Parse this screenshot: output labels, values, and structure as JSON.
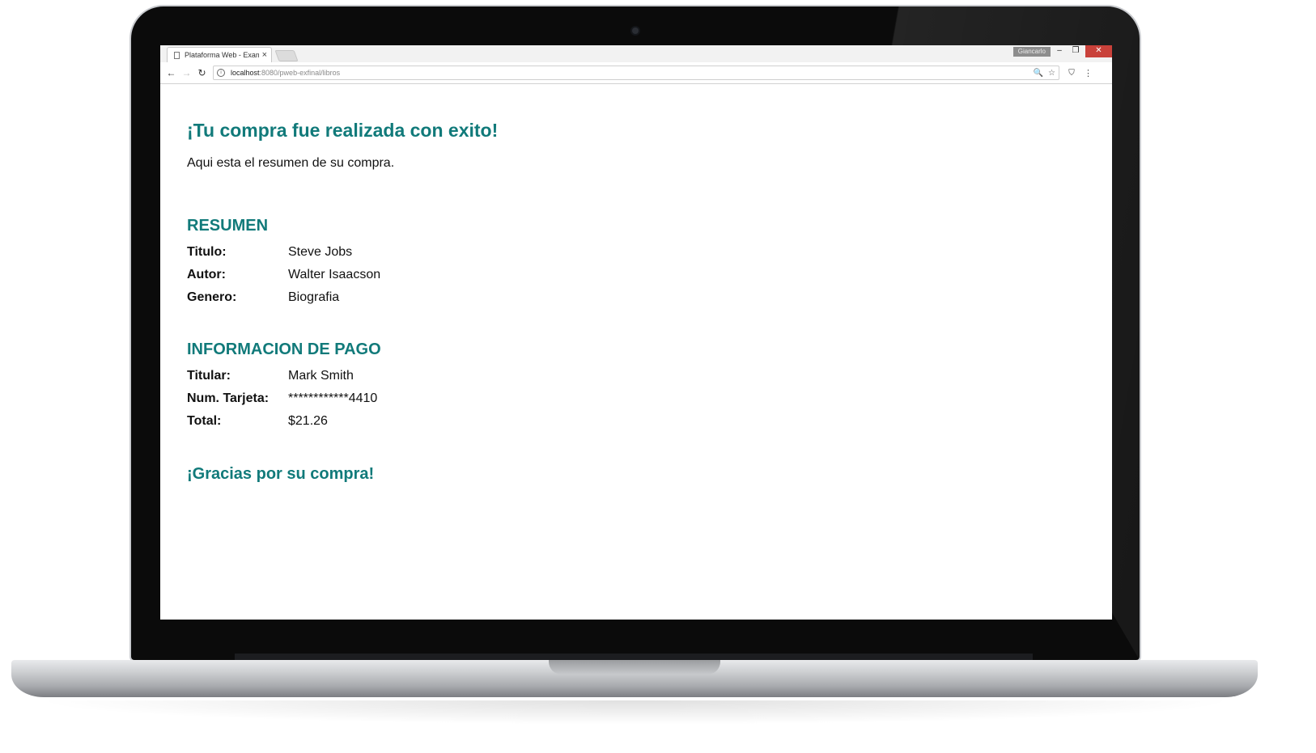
{
  "browser": {
    "tab_title": "Plataforma Web - Exame",
    "tab_close": "×",
    "profile_name": "Giancarlo",
    "window": {
      "minimize": "–",
      "restore": "❐",
      "close": "✕"
    },
    "nav": {
      "back": "←",
      "forward": "→",
      "reload": "↻"
    },
    "url_host": "localhost",
    "url_rest": ":8080/pweb-exfinal/libros",
    "zoom_icon": "🔍",
    "star_icon": "☆",
    "extension_icon": "⛉",
    "menu_icon": "⋮"
  },
  "page": {
    "heading": "¡Tu compra fue realizada con exito!",
    "intro": "Aqui esta el resumen de su compra.",
    "summary": {
      "title": "RESUMEN",
      "rows": [
        {
          "label": "Titulo:",
          "value": "Steve Jobs"
        },
        {
          "label": "Autor:",
          "value": "Walter Isaacson"
        },
        {
          "label": "Genero:",
          "value": "Biografia"
        }
      ]
    },
    "payment": {
      "title": "INFORMACION DE PAGO",
      "rows": [
        {
          "label": "Titular:",
          "value": "Mark Smith"
        },
        {
          "label": "Num. Tarjeta:",
          "value": "************4410"
        },
        {
          "label": "Total:",
          "value": "$21.26"
        }
      ]
    },
    "thanks": "¡Gracias por su compra!"
  },
  "colors": {
    "accent": "#117a7a",
    "close_button": "#c9413a"
  }
}
